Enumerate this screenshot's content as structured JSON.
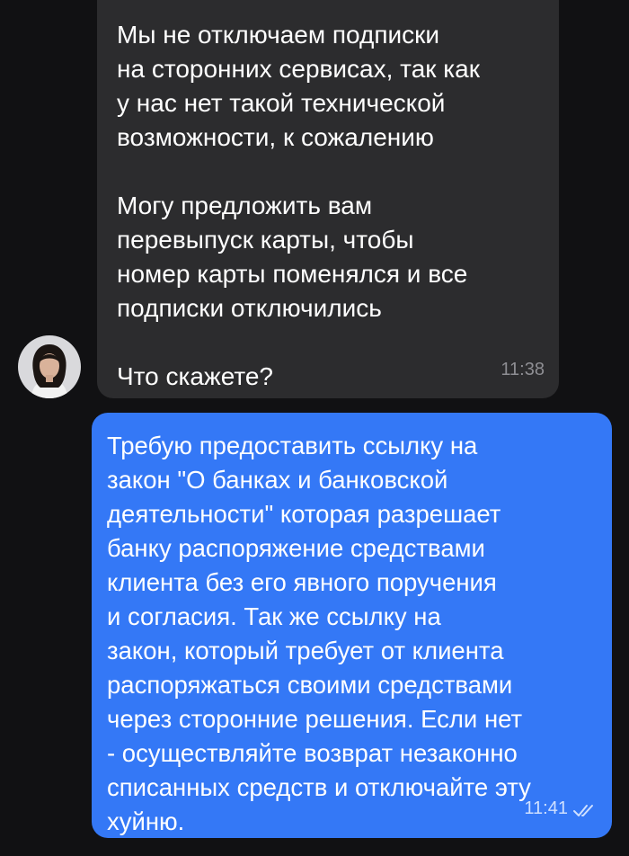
{
  "chat": {
    "incoming": {
      "text": "Мы не отключаем подписки\nна сторонних сервисах, так как\nу нас нет такой технической\nвозможности, к сожалению\n\nМогу предложить вам\nперевыпуск карты, чтобы\nномер карты поменялся и все\nподписки отключились\n\nЧто скажете?",
      "time": "11:38"
    },
    "outgoing": {
      "text": "Требую предоставить ссылку на\nзакон \"О банках и банковской\nдеятельности\" которая разрешает\nбанку распоряжение средствами\nклиента без его явного поручения\nи согласия. Так же ссылку на\nзакон, который требует от клиента\nраспоряжаться своими средствами\nчерез сторонние решения. Если нет\n- осуществляйте возврат незаконно\nсписанных средств и отключайте эту\nхуйню.",
      "time": "11:41",
      "status_icon": "double-check-icon"
    }
  },
  "colors": {
    "background": "#111113",
    "incoming_bubble": "#2c2c2e",
    "outgoing_bubble": "#3478f6",
    "incoming_time": "#8e8e93",
    "outgoing_time": "#cfe0ff"
  }
}
